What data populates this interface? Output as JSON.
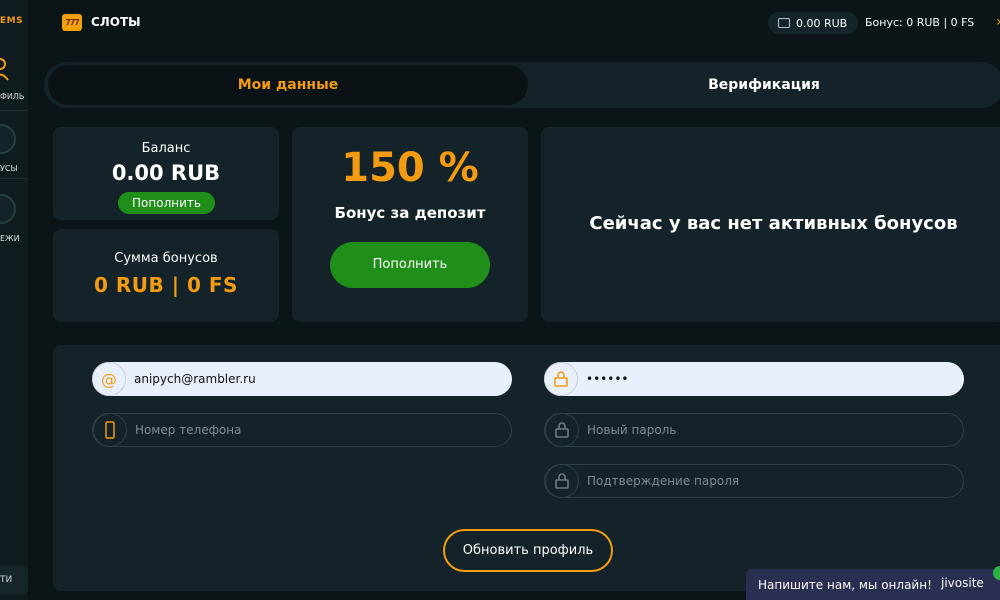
{
  "sidebar": {
    "brand": "EMS",
    "items": [
      {
        "label": "ФИЛЬ",
        "icon": "user-icon"
      },
      {
        "label": "УСЫ",
        "icon": "gift-icon"
      },
      {
        "label": "ЕЖИ",
        "icon": "card-icon"
      }
    ],
    "logout_label": "ТИ"
  },
  "topbar": {
    "slots_icon_text": "777",
    "slots_label": "СЛОТЫ",
    "wallet_balance": "0.00 RUB",
    "bonus_text": "Бонус: 0 RUB | 0 FS"
  },
  "tabs": [
    {
      "label": "Мои данные",
      "active": true
    },
    {
      "label": "Верификация",
      "active": false
    }
  ],
  "balance_card": {
    "title": "Баланс",
    "value": "0.00 RUB",
    "button": "Пополнить"
  },
  "bonus_sum_card": {
    "title": "Сумма бонусов",
    "value": "0 RUB | 0 FS"
  },
  "promo_card": {
    "percent": "150 %",
    "label": "Бонус за депозит",
    "button": "Пополнить"
  },
  "active_bonuses": {
    "message": "Сейчас у вас нет активных бонусов"
  },
  "form": {
    "email_value": "anipych@rambler.ru",
    "password_value": "••••••",
    "phone_placeholder": "Номер телефона",
    "new_password_placeholder": "Новый пароль",
    "confirm_password_placeholder": "Подтверждение пароля",
    "submit": "Обновить профиль"
  },
  "chat": {
    "message": "Напишите нам, мы онлайн!",
    "brand": "jivosite"
  },
  "colors": {
    "accent": "#f39c12",
    "green": "#1f8f1a",
    "background": "#0b1518",
    "card": "#14232a"
  }
}
